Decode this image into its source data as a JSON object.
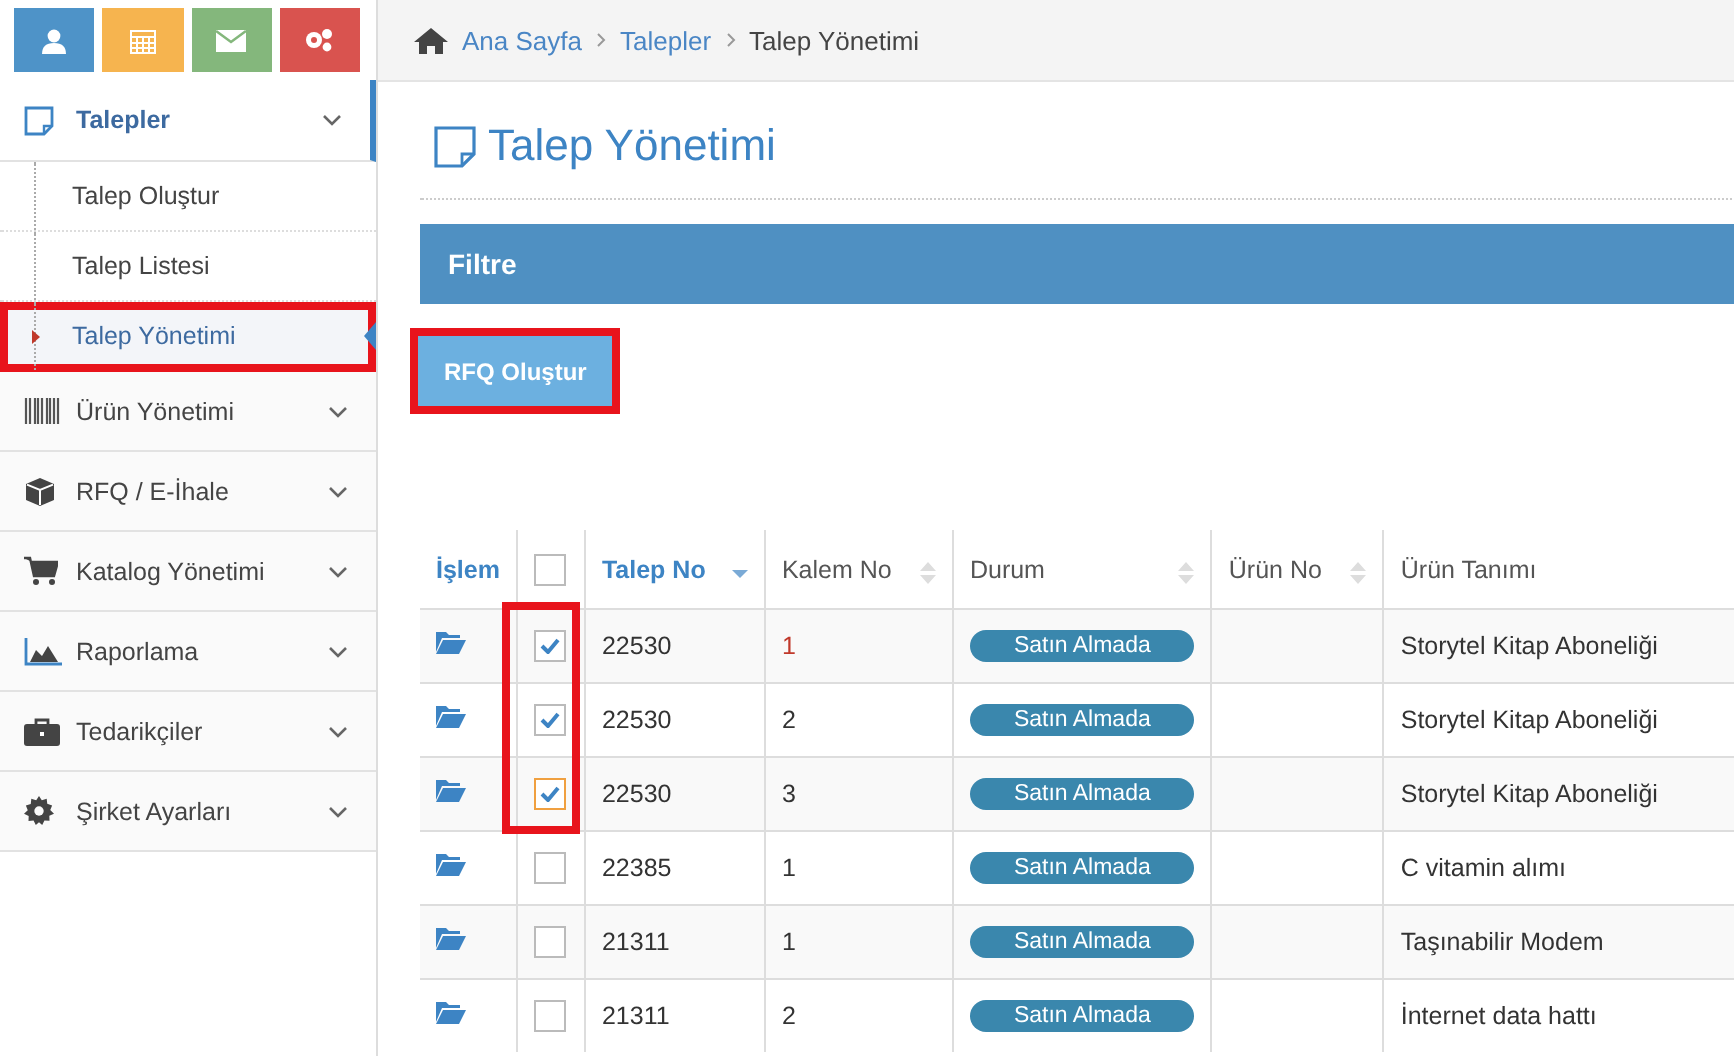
{
  "sidebar": {
    "top_buttons": [
      {
        "kind": "user",
        "color": "#4e93c8"
      },
      {
        "kind": "calendar",
        "color": "#f6b44f"
      },
      {
        "kind": "mail",
        "color": "#84b77c"
      },
      {
        "kind": "settings",
        "color": "#d9534f"
      }
    ],
    "menu": [
      {
        "label": "Talepler",
        "kind": "doc",
        "expanded": true,
        "children": [
          {
            "label": "Talep Oluştur",
            "selected": false,
            "highlighted": false
          },
          {
            "label": "Talep Listesi",
            "selected": false,
            "highlighted": false
          },
          {
            "label": "Talep Yönetimi",
            "selected": true,
            "highlighted": true
          }
        ]
      },
      {
        "label": "Ürün Yönetimi",
        "kind": "barcode",
        "expanded": false
      },
      {
        "label": "RFQ / E-İhale",
        "kind": "cube",
        "expanded": false
      },
      {
        "label": "Katalog Yönetimi",
        "kind": "cart",
        "expanded": false
      },
      {
        "label": "Raporlama",
        "kind": "chart",
        "expanded": false
      },
      {
        "label": "Tedarikçiler",
        "kind": "briefcase",
        "expanded": false
      },
      {
        "label": "Şirket Ayarları",
        "kind": "gear",
        "expanded": false
      }
    ]
  },
  "breadcrumb": [
    "Ana Sayfa",
    "Talepler",
    "Talep Yönetimi"
  ],
  "page_title": "Talep Yönetimi",
  "filter_panel": {
    "title": "Filtre"
  },
  "rfq_button": {
    "label": "RFQ Oluştur",
    "highlighted": true
  },
  "table": {
    "columns": [
      {
        "label": "İşlem",
        "kind": "link"
      },
      {
        "kind": "check",
        "checked": false
      },
      {
        "label": "Talep No",
        "kind": "sorted"
      },
      {
        "label": "Kalem No",
        "kind": "sortable"
      },
      {
        "label": "Durum",
        "kind": "sortable"
      },
      {
        "label": "Ürün No",
        "kind": "sortable"
      },
      {
        "label": "Ürün Tanımı",
        "kind": "plain"
      }
    ],
    "rows": [
      {
        "checked": true,
        "focused": false,
        "highlighted": true,
        "talep_no": "22530",
        "kalem_no": "1",
        "kalem_red": true,
        "durum": "Satın Almada",
        "urun_tanimi": "Storytel Kitap Aboneliği"
      },
      {
        "checked": true,
        "focused": false,
        "highlighted": true,
        "talep_no": "22530",
        "kalem_no": "2",
        "kalem_red": false,
        "durum": "Satın Almada",
        "urun_tanimi": "Storytel Kitap Aboneliği"
      },
      {
        "checked": true,
        "focused": true,
        "highlighted": true,
        "talep_no": "22530",
        "kalem_no": "3",
        "kalem_red": false,
        "durum": "Satın Almada",
        "urun_tanimi": "Storytel Kitap Aboneliği"
      },
      {
        "checked": false,
        "focused": false,
        "highlighted": false,
        "talep_no": "22385",
        "kalem_no": "1",
        "kalem_red": false,
        "durum": "Satın Almada",
        "urun_tanimi": "C vitamin alımı"
      },
      {
        "checked": false,
        "focused": false,
        "highlighted": false,
        "talep_no": "21311",
        "kalem_no": "1",
        "kalem_red": false,
        "durum": "Satın Almada",
        "urun_tanimi": "Taşınabilir Modem"
      },
      {
        "checked": false,
        "focused": false,
        "highlighted": false,
        "talep_no": "21311",
        "kalem_no": "2",
        "kalem_red": false,
        "durum": "Satın Almada",
        "urun_tanimi": "İnternet data hattı"
      }
    ]
  }
}
